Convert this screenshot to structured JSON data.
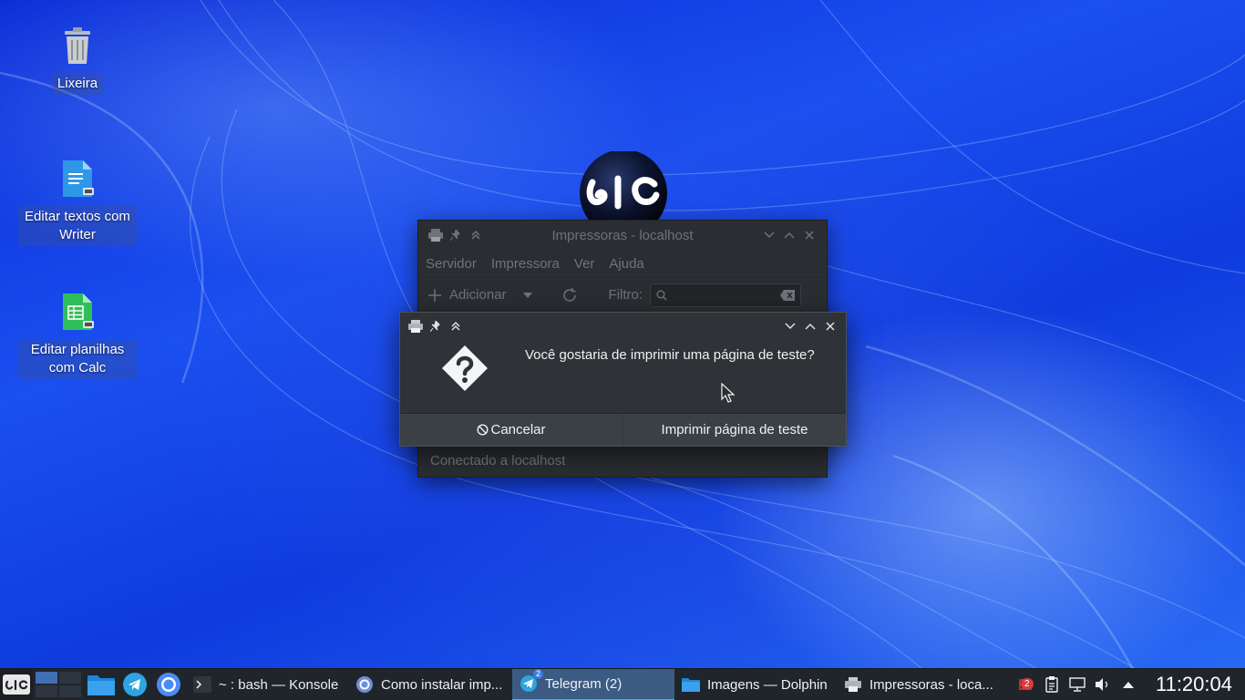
{
  "desktop": {
    "icons": [
      {
        "label": "Lixeira"
      },
      {
        "label": "Editar textos com Writer"
      },
      {
        "label": "Editar planilhas com Calc"
      }
    ]
  },
  "printer_window": {
    "title": "Impressoras - localhost",
    "menu": [
      "Servidor",
      "Impressora",
      "Ver",
      "Ajuda"
    ],
    "toolbar": {
      "add_label": "Adicionar",
      "filter_label": "Filtro:",
      "filter_value": ""
    },
    "status": "Conectado a localhost"
  },
  "dialog": {
    "message": "Você gostaria de imprimir uma página de teste?",
    "cancel_label": "Cancelar",
    "confirm_label": "Imprimir página de teste"
  },
  "taskbar": {
    "tasks": [
      {
        "label": "~ : bash — Konsole",
        "icon": "terminal-icon"
      },
      {
        "label": "Como instalar imp...",
        "icon": "chromium-icon"
      },
      {
        "label": "Telegram (2)",
        "icon": "telegram-icon",
        "badge": "2",
        "active": true
      },
      {
        "label": "Imagens — Dolphin",
        "icon": "folder-icon"
      },
      {
        "label": "Impressoras - loca...",
        "icon": "printer-icon"
      }
    ],
    "tray": {
      "notification_count": "2"
    },
    "clock": "11:20:04"
  },
  "colors": {
    "accent": "#62a0ea",
    "window_bg": "#2a2e32",
    "dialog_bg": "#2f3337",
    "taskbar_bg": "#20252b",
    "badge_red": "#da3b3b"
  }
}
